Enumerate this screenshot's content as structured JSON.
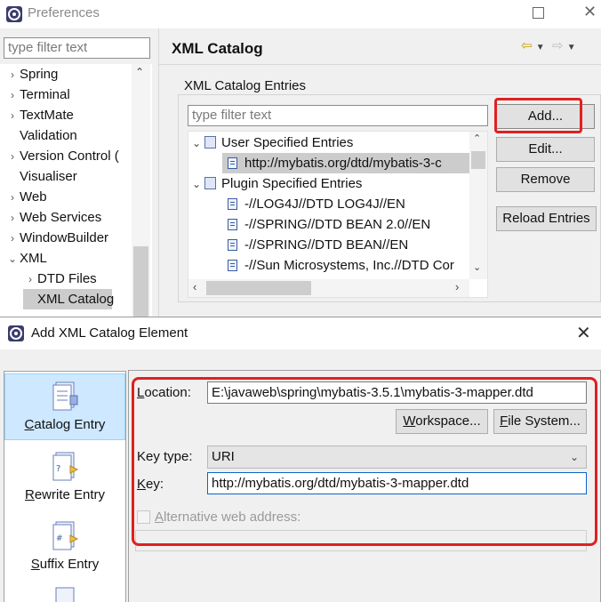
{
  "preferences": {
    "title": "Preferences",
    "filter_placeholder": "type filter text",
    "tree": [
      {
        "label": "Spring",
        "arrow": "›",
        "indent": 0
      },
      {
        "label": "Terminal",
        "arrow": "›",
        "indent": 0
      },
      {
        "label": "TextMate",
        "arrow": "›",
        "indent": 0
      },
      {
        "label": "Validation",
        "arrow": "",
        "indent": 0
      },
      {
        "label": "Version Control (",
        "arrow": "›",
        "indent": 0
      },
      {
        "label": "Visualiser",
        "arrow": "",
        "indent": 0
      },
      {
        "label": "Web",
        "arrow": "›",
        "indent": 0
      },
      {
        "label": "Web Services",
        "arrow": "›",
        "indent": 0
      },
      {
        "label": "WindowBuilder",
        "arrow": "›",
        "indent": 0
      },
      {
        "label": "XML",
        "arrow": "⌄",
        "indent": 0
      },
      {
        "label": "DTD Files",
        "arrow": "›",
        "indent": 1
      },
      {
        "label": "XML Catalog",
        "arrow": "",
        "indent": 1,
        "selected": true
      }
    ],
    "page_title": "XML Catalog",
    "group_label": "XML Catalog Entries",
    "catalog_filter_placeholder": "type filter text",
    "catalog_tree": {
      "user_entries": "User Specified Entries",
      "user_item": "http://mybatis.org/dtd/mybatis-3-c",
      "plugin_entries": "Plugin Specified Entries",
      "plugin_items": [
        "-//LOG4J//DTD LOG4J//EN",
        "-//SPRING//DTD BEAN 2.0//EN",
        "-//SPRING//DTD BEAN//EN",
        "-//Sun Microsystems, Inc.//DTD Cor"
      ]
    },
    "buttons": {
      "add": "Add...",
      "edit": "Edit...",
      "remove": "Remove",
      "reload": "Reload Entries"
    }
  },
  "dialog": {
    "title": "Add XML Catalog Element",
    "side_items": {
      "catalog": {
        "pre": "",
        "ul": "C",
        "post": "atalog Entry"
      },
      "rewrite": {
        "pre": "",
        "ul": "R",
        "post": "ewrite Entry"
      },
      "suffix": {
        "pre": "",
        "ul": "S",
        "post": "uffix Entry"
      }
    },
    "location": {
      "pre": "",
      "ul": "L",
      "post": "ocation:",
      "value": "E:\\javaweb\\spring\\mybatis-3.5.1\\mybatis-3-mapper.dtd"
    },
    "workspace_button": {
      "pre": "",
      "ul": "W",
      "post": "orkspace..."
    },
    "filesystem_button": {
      "pre": "",
      "ul": "F",
      "post": "ile System..."
    },
    "key_type": {
      "label": "Key type:",
      "value": "URI"
    },
    "key": {
      "pre": "",
      "ul": "K",
      "post": "ey:",
      "value": "http://mybatis.org/dtd/mybatis-3-mapper.dtd"
    },
    "alternative": {
      "pre": "",
      "ul": "A",
      "post": "lternative web address:"
    }
  },
  "colors": {
    "highlight": "#e02020",
    "selection": "#cde8ff"
  }
}
